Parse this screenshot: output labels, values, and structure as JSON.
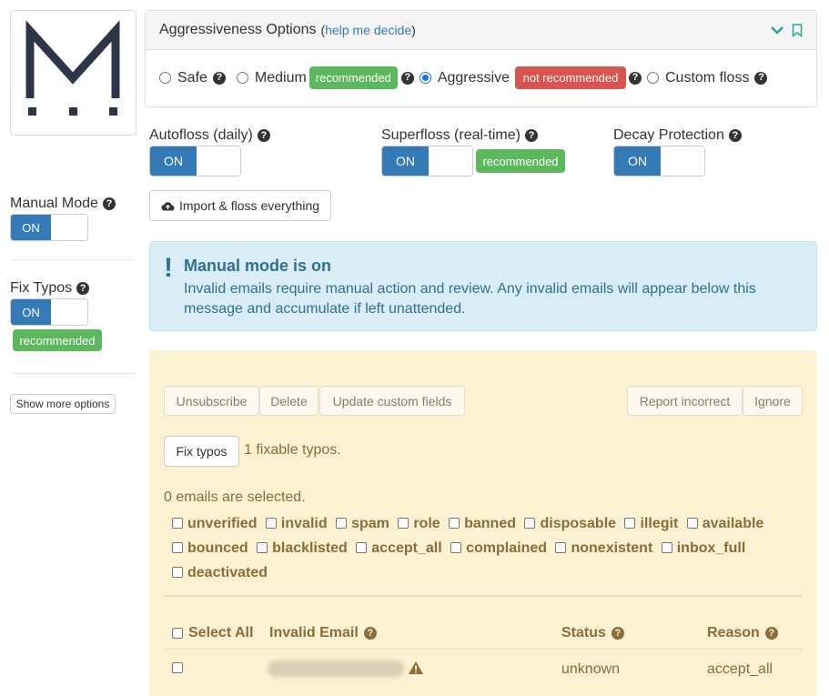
{
  "sidebar": {
    "logo_letter": "M",
    "manual_mode": {
      "label": "Manual Mode",
      "toggle_on": "ON"
    },
    "fix_typos": {
      "label": "Fix Typos",
      "toggle_on": "ON",
      "badge": "recommended"
    },
    "show_more_label": "Show more options"
  },
  "options": {
    "title": "Aggressiveness Options",
    "help_paren_open": "(",
    "help_link": "help me decide",
    "help_paren_close": ")",
    "radios": [
      {
        "label": "Safe",
        "checked": false
      },
      {
        "label": "Medium",
        "badge": "recommended",
        "checked": false
      },
      {
        "label": "Aggressive",
        "badge": "not recommended",
        "checked": true
      },
      {
        "label": "Custom floss",
        "checked": false
      }
    ]
  },
  "toggles": {
    "autofloss": {
      "label": "Autofloss (daily)",
      "on": "ON"
    },
    "superfloss": {
      "label": "Superfloss (real-time)",
      "on": "ON",
      "badge": "recommended"
    },
    "decay": {
      "label": "Decay Protection",
      "on": "ON"
    }
  },
  "import_button": "Import & floss everything",
  "alert": {
    "icon": "!",
    "title": "Manual mode is on",
    "body": "Invalid emails require manual action and review. Any invalid emails will appear below this message and accumulate if left unattended."
  },
  "actions": {
    "unsubscribe": "Unsubscribe",
    "delete": "Delete",
    "update_fields": "Update custom fields",
    "report_incorrect": "Report incorrect",
    "ignore": "Ignore",
    "fix_typos": "Fix typos",
    "fixable_text": "1 fixable typos.",
    "selected_text": "0 emails are selected."
  },
  "filters": {
    "row1": [
      "unverified",
      "invalid",
      "spam",
      "role",
      "banned",
      "disposable",
      "illegit",
      "available"
    ],
    "row2": [
      "bounced",
      "blacklisted",
      "accept_all",
      "complained",
      "nonexistent",
      "inbox_full"
    ],
    "row3": [
      "deactivated"
    ]
  },
  "table": {
    "headers": {
      "select_all": "Select All",
      "email": "Invalid Email",
      "status": "Status",
      "reason": "Reason"
    },
    "rows": [
      {
        "status": "unknown",
        "reason": "accept_all"
      }
    ]
  },
  "colors": {
    "primary": "#337ab7",
    "success": "#5cb85c",
    "danger": "#d9534f",
    "info_bg": "#d9edf7",
    "warning_bg": "#fcf1d0",
    "warning_text": "#8a6d3b",
    "teal_icon": "#26a69a"
  }
}
